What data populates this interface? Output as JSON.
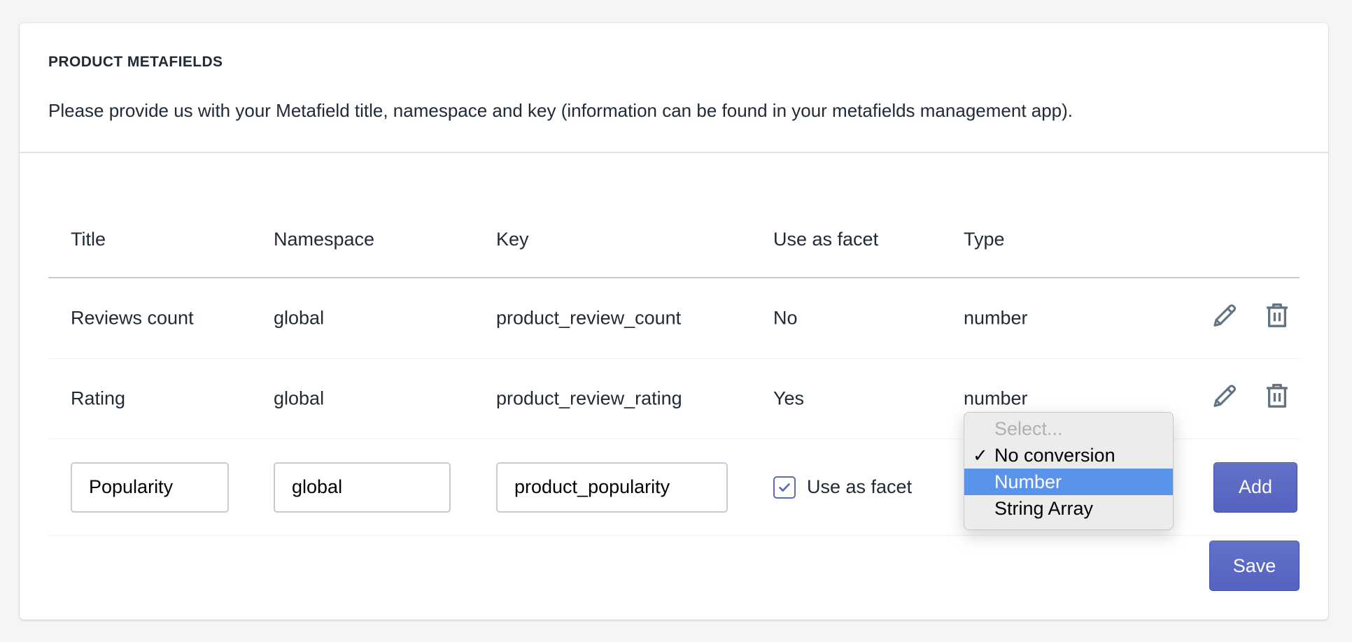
{
  "section": {
    "title": "PRODUCT METAFIELDS",
    "description": "Please provide us with your Metafield title, namespace and key (information can be found in your metafields management app)."
  },
  "table": {
    "headers": [
      "Title",
      "Namespace",
      "Key",
      "Use as facet",
      "Type"
    ],
    "rows": [
      {
        "title": "Reviews count",
        "namespace": "global",
        "key": "product_review_count",
        "use_as_facet": "No",
        "type": "number"
      },
      {
        "title": "Rating",
        "namespace": "global",
        "key": "product_review_rating",
        "use_as_facet": "Yes",
        "type": "number"
      }
    ],
    "row_actions": {
      "edit_icon": "pencil-icon",
      "delete_icon": "trash-icon"
    }
  },
  "new_row": {
    "title_value": "Popularity",
    "namespace_value": "global",
    "key_value": "product_popularity",
    "use_as_facet_checked": true,
    "use_as_facet_label": "Use as facet",
    "add_label": "Add"
  },
  "type_dropdown": {
    "placeholder": "Select...",
    "options": [
      {
        "label": "No conversion",
        "checked": true,
        "highlighted": false
      },
      {
        "label": "Number",
        "checked": false,
        "highlighted": true
      },
      {
        "label": "String Array",
        "checked": false,
        "highlighted": false
      }
    ],
    "check_glyph": "✓"
  },
  "footer": {
    "save_label": "Save"
  },
  "colors": {
    "primary": "#5c6ac4",
    "highlight": "#5a93ec",
    "icon": "#637381"
  }
}
